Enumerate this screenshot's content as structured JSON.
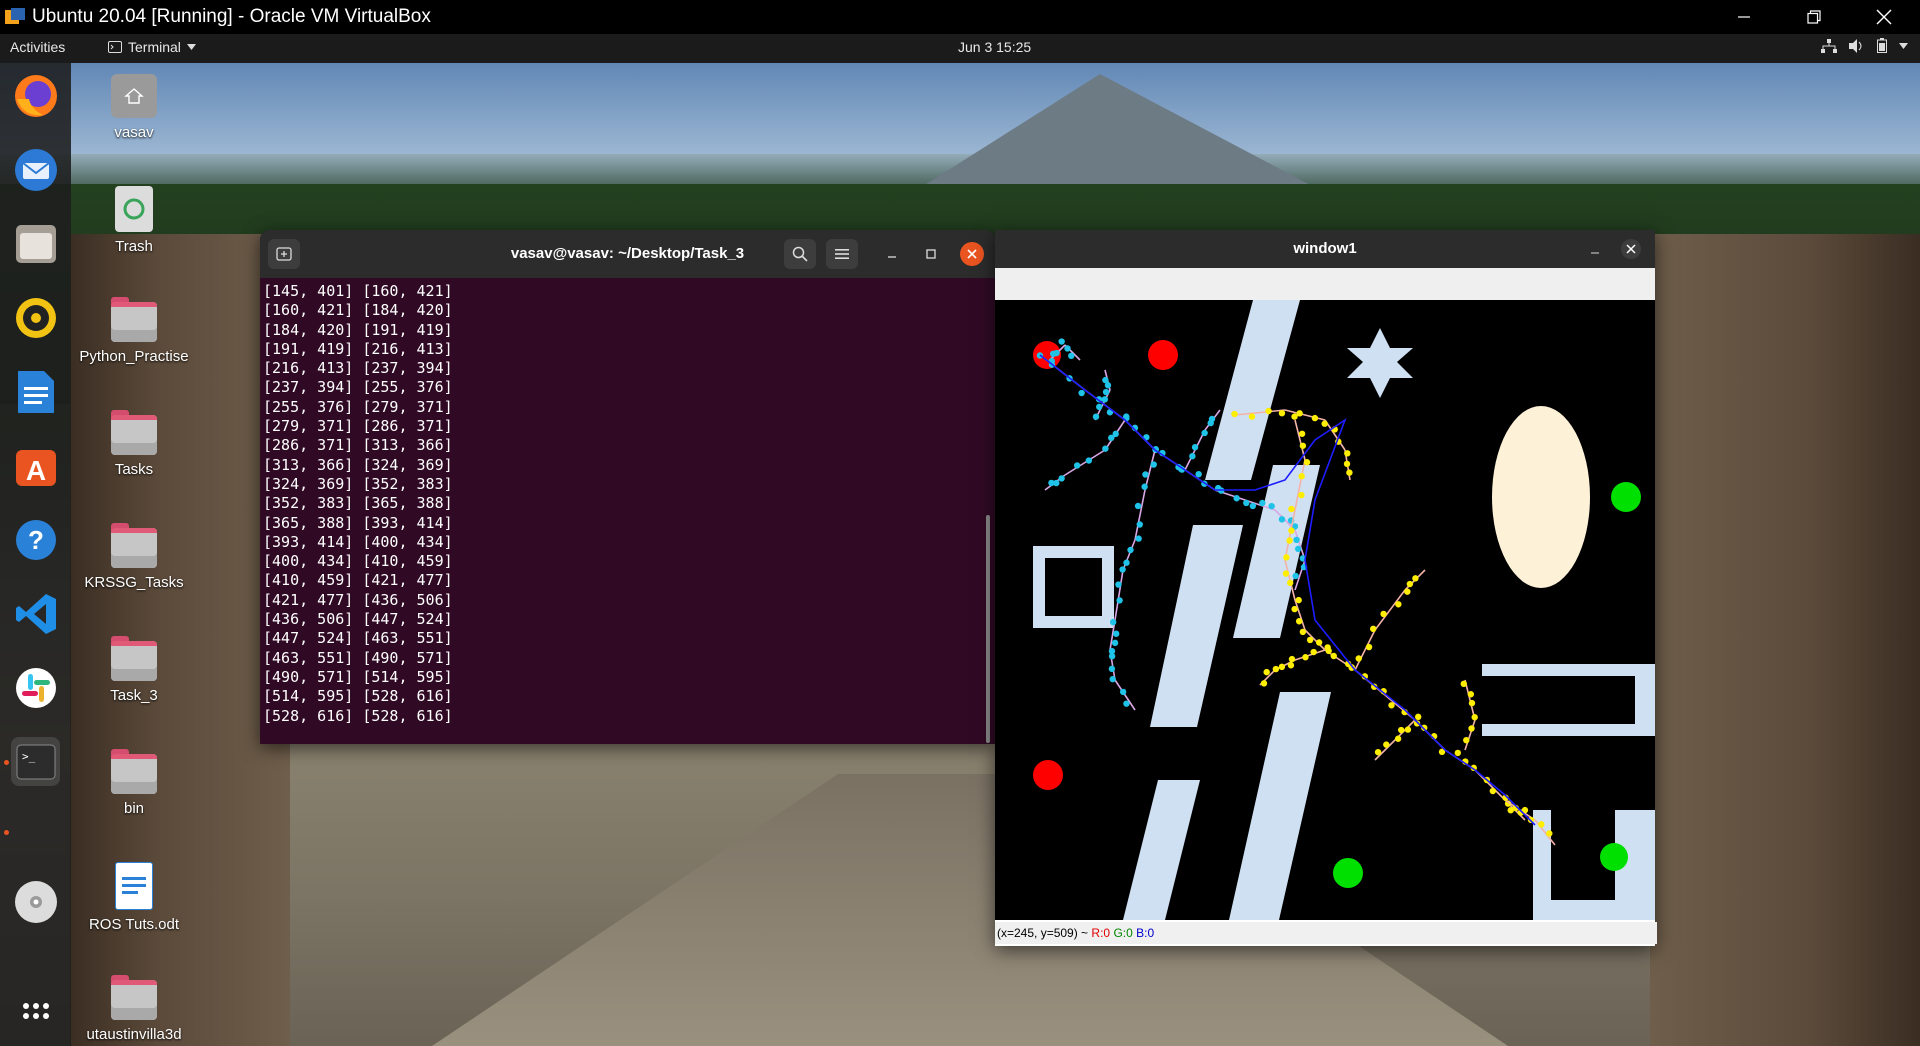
{
  "host": {
    "title": "Ubuntu 20.04 [Running] - Oracle VM VirtualBox",
    "controls": [
      "minimize",
      "restore",
      "close"
    ]
  },
  "gnome": {
    "activities": "Activities",
    "app_menu": "Terminal",
    "clock": "Jun 3  15:25"
  },
  "dock": {
    "apps": [
      "firefox-icon",
      "thunderbird-icon",
      "files-icon",
      "rhythmbox-icon",
      "libreoffice-writer-icon",
      "software-icon",
      "help-icon",
      "vscode-icon",
      "slack-icon",
      "terminal-icon",
      "dvd-icon",
      "show-apps-icon"
    ]
  },
  "desktop_icons": [
    {
      "label": "vasav",
      "type": "home"
    },
    {
      "label": "Trash",
      "type": "trash"
    },
    {
      "label": "Python_Practise",
      "type": "folder"
    },
    {
      "label": "Tasks",
      "type": "folder"
    },
    {
      "label": "KRSSG_Tasks",
      "type": "folder"
    },
    {
      "label": "Task_3",
      "type": "folder"
    },
    {
      "label": "bin",
      "type": "folder"
    },
    {
      "label": "ROS Tuts.odt",
      "type": "document"
    },
    {
      "label": "utaustinvilla3d",
      "type": "folder"
    }
  ],
  "terminal": {
    "title": "vasav@vasav: ~/Desktop/Task_3",
    "lines": [
      "[145, 401] [160, 421]",
      "[160, 421] [184, 420]",
      "[184, 420] [191, 419]",
      "[191, 419] [216, 413]",
      "[216, 413] [237, 394]",
      "[237, 394] [255, 376]",
      "[255, 376] [279, 371]",
      "[279, 371] [286, 371]",
      "[286, 371] [313, 366]",
      "[313, 366] [324, 369]",
      "[324, 369] [352, 383]",
      "[352, 383] [365, 388]",
      "[365, 388] [393, 414]",
      "[393, 414] [400, 434]",
      "[400, 434] [410, 459]",
      "[410, 459] [421, 477]",
      "[421, 477] [436, 506]",
      "[436, 506] [447, 524]",
      "[447, 524] [463, 551]",
      "[463, 551] [490, 571]",
      "[490, 571] [514, 595]",
      "[514, 595] [528, 616]",
      "[528, 616] [528, 616]"
    ]
  },
  "window1": {
    "title": "window1",
    "status_coords": "(x=245, y=509) ~ ",
    "status_r": "R:0",
    "status_g": "G:0",
    "status_b": "B:0",
    "colors": {
      "start": "#ff0000",
      "goal": "#00dd00",
      "obstacle": "#cfe0f2",
      "ellipse": "#fdf1d8",
      "tree_a": "#1fc3e8",
      "tree_b": "#ffee00",
      "path": "#1d1dff"
    }
  }
}
